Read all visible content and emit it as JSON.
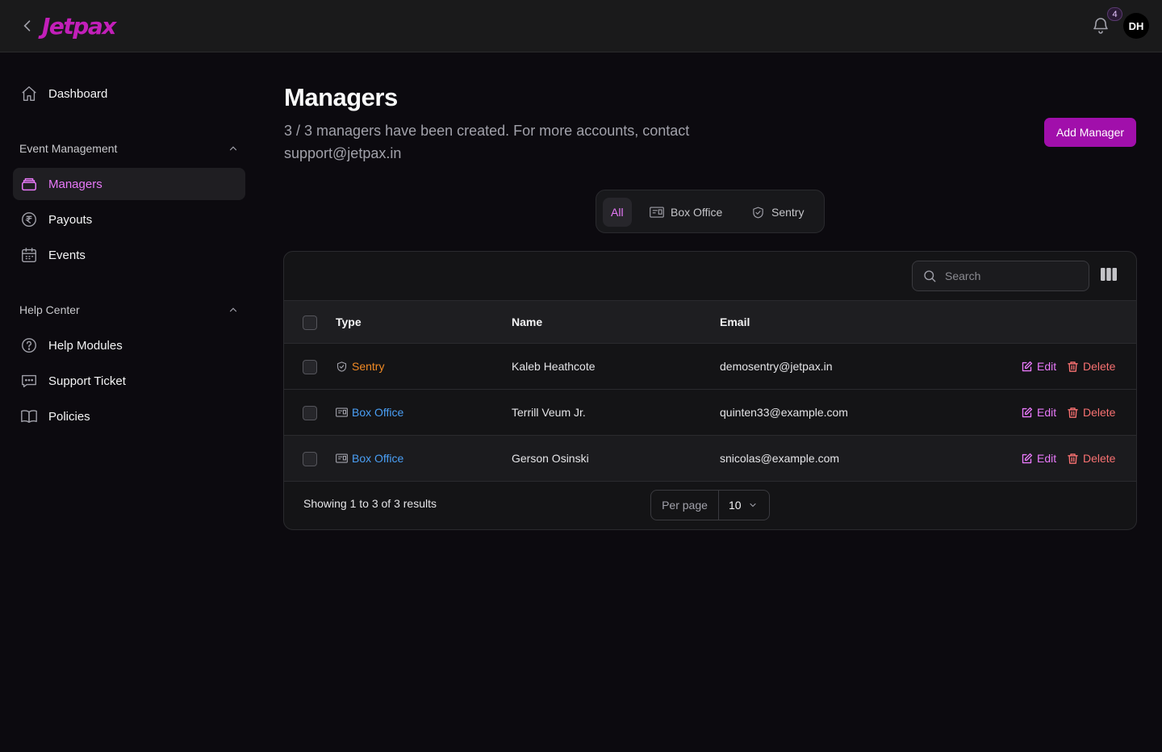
{
  "header": {
    "logo_text": "Jetpax",
    "notification_count": "4",
    "avatar_initials": "DH"
  },
  "sidebar": {
    "dashboard": "Dashboard",
    "groups": [
      {
        "title": "Event Management",
        "items": [
          "Managers",
          "Payouts",
          "Events"
        ]
      },
      {
        "title": "Help Center",
        "items": [
          "Help Modules",
          "Support Ticket",
          "Policies"
        ]
      }
    ],
    "active_item": "Managers"
  },
  "main": {
    "title": "Managers",
    "description": "3 / 3 managers have been created. For more accounts, contact support@jetpax.in",
    "add_button": "Add Manager",
    "tabs": [
      {
        "label": "All",
        "active": true
      },
      {
        "label": "Box Office",
        "icon": "ticket-icon"
      },
      {
        "label": "Sentry",
        "icon": "shield-icon"
      }
    ],
    "search": {
      "placeholder": "Search"
    },
    "table": {
      "columns": [
        "Type",
        "Name",
        "Email"
      ],
      "rows": [
        {
          "type": "Sentry",
          "name": "Kaleb Heathcote",
          "email": "demosentry@jetpax.in"
        },
        {
          "type": "Box Office",
          "name": "Terrill Veum Jr.",
          "email": "quinten33@example.com"
        },
        {
          "type": "Box Office",
          "name": "Gerson Osinski",
          "email": "snicolas@example.com"
        }
      ],
      "edit_label": "Edit",
      "delete_label": "Delete"
    },
    "footer": {
      "showing": "Showing 1 to 3 of 3 results",
      "per_page_label": "Per page",
      "per_page_value": "10"
    }
  },
  "colors": {
    "accent": "#e879f9",
    "button": "#a10fab",
    "sentry": "#f08a24",
    "box_office": "#4a9ff5",
    "delete": "#f87171"
  }
}
